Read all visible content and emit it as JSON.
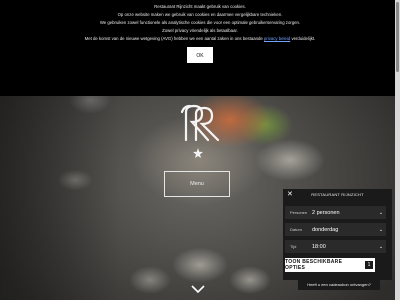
{
  "cookie_banner": {
    "lines": [
      "Restaurant Rijnzicht maakt gebruik van cookies.",
      "Op onze website maken we gebruik van cookies en daarmee vergelijkbare technieken.",
      "We gebruiken zowel functionele als analytische cookies die voor een optimale gebruikerservaring zorgen.",
      "Zowel privacy vriendelijk als betaalbaar."
    ],
    "last_line_before": "Met de komst van de nieuwe wetgeving (AVG) hebben we een aantal zaken in ons bestaande ",
    "last_line_link": "privacy beleid",
    "last_line_after": " verduidelijkt.",
    "ok_label": "OK"
  },
  "menu_label": "Menu",
  "widget": {
    "title": "RESTAURANT RIJNZICHT",
    "close": "✕",
    "rows": [
      {
        "label": "Personen",
        "value": "2 personen"
      },
      {
        "label": "Datum",
        "value": "donderdag"
      },
      {
        "label": "Tijd",
        "value": "18:00"
      }
    ],
    "button_label": "TOON BESCHIKBARE OPTIES",
    "button_count": "1",
    "gift_text": "Heeft u een cadeaubon ontvangen?"
  },
  "icons": {
    "logo": "rr-logo",
    "scroll": "chevron-down-icon"
  }
}
